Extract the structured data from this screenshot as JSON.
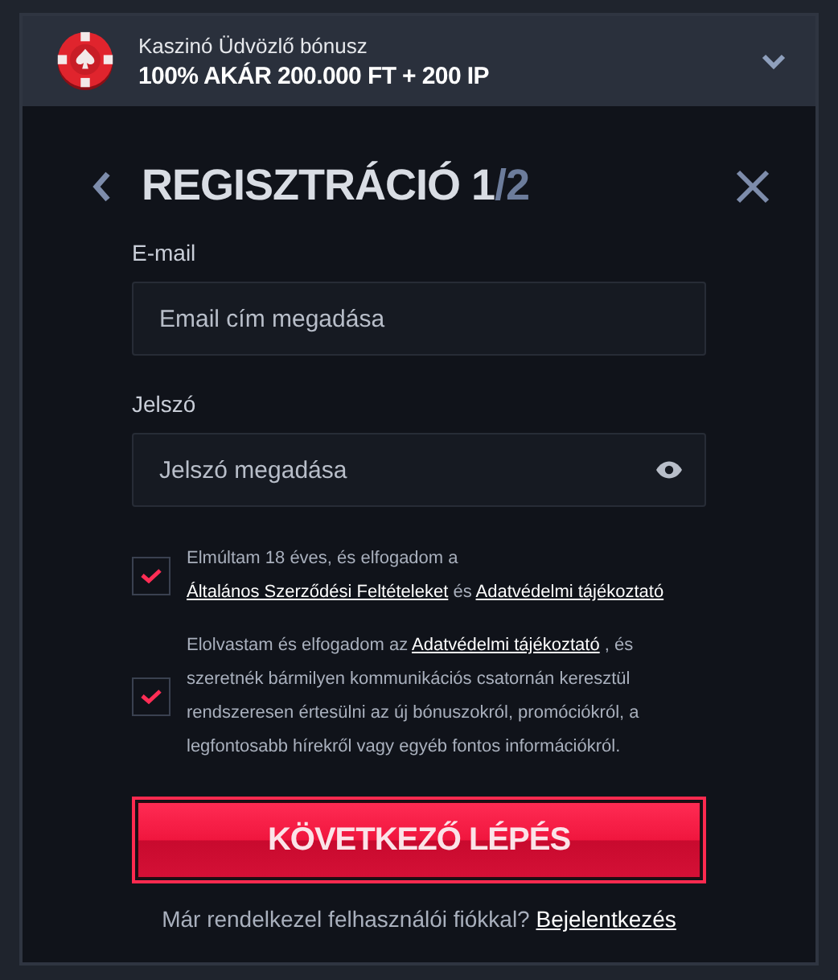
{
  "bonus_banner": {
    "subtitle": "Kaszinó Üdvözlő bónusz",
    "title": "100% AKÁR 200.000 FT + 200 IP",
    "expanded": false
  },
  "header": {
    "title": "REGISZTRÁCIÓ 1",
    "step_total": "/2"
  },
  "fields": [
    {
      "label": "E-mail",
      "placeholder": "Email cím megadása",
      "kind": "text"
    },
    {
      "label": "Jelszó",
      "placeholder": "Jelszó megadása",
      "kind": "password"
    }
  ],
  "consents": [
    {
      "checked": true,
      "parts": [
        {
          "kind": "plain",
          "text": "Elmúltam 18 éves, és elfogadom a"
        },
        {
          "kind": "break"
        },
        {
          "kind": "link",
          "text": "Általános Szerződési Feltételeket"
        },
        {
          "kind": "plain",
          "text": " és "
        },
        {
          "kind": "link",
          "text": "Adatvédelmi tájékoztató"
        }
      ]
    },
    {
      "checked": true,
      "parts": [
        {
          "kind": "plain",
          "text": "Elolvastam és elfogadom az "
        },
        {
          "kind": "link",
          "text": "Adatvédelmi tájékoztató"
        },
        {
          "kind": "plain",
          "text": " , és szeretnék bármilyen kommunikációs csatornán keresztül rendszeresen értesülni az új bónuszokról, promóciókról, a legfontosabb hírekről vagy egyéb fontos információkról."
        }
      ]
    }
  ],
  "submit_button": "KÖVETKEZŐ LÉPÉS",
  "login_prompt": {
    "text": "Már rendelkezel felhasználói fiókkal? ",
    "link": "Bejelentkezés"
  }
}
